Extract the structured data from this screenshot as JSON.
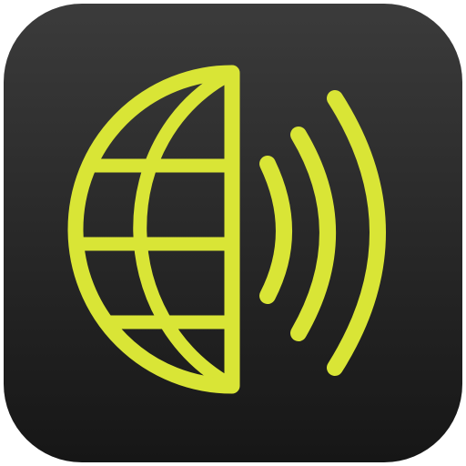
{
  "icon": {
    "name": "globe-sound-waves-app-icon",
    "glyphs": [
      "half-globe-icon",
      "sound-waves-icon"
    ],
    "colors": {
      "background_top": "#3b3b3b",
      "background_bottom": "#161616",
      "accent": "#d9e536",
      "outline": "#151515"
    }
  }
}
